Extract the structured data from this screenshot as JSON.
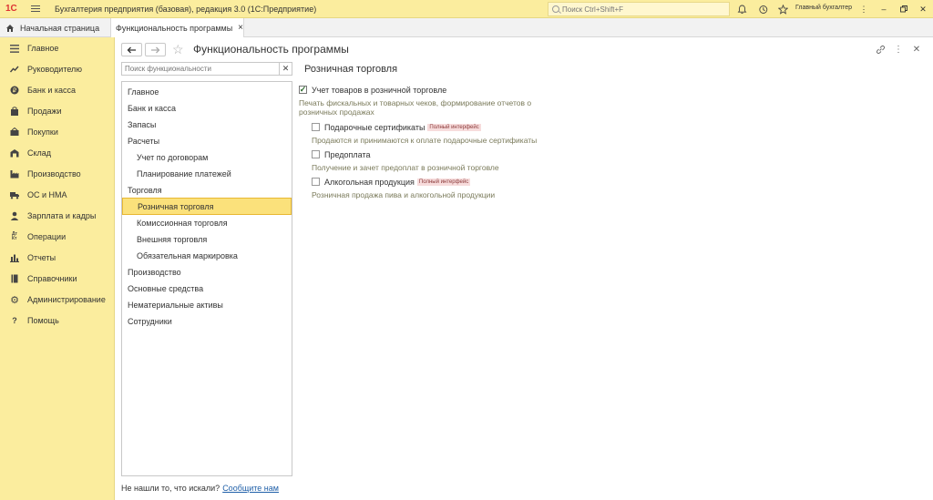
{
  "titlebar": {
    "logo": "1С",
    "app_title": "Бухгалтерия предприятия (базовая), редакция 3.0  (1С:Предприятие)",
    "search_placeholder": "Поиск Ctrl+Shift+F",
    "user": "Главный бухгалтер",
    "icons": [
      "bell-icon",
      "history-icon",
      "star-icon",
      "settings-icon"
    ],
    "window_buttons": [
      "minimize",
      "restore",
      "close"
    ]
  },
  "tabs": {
    "home_label": "Начальная страница",
    "active_label": "Функциональность программы",
    "close_symbol": "×"
  },
  "sidebar": {
    "items": [
      {
        "label": "Главное",
        "icon": "menu-icon"
      },
      {
        "label": "Руководителю",
        "icon": "chart-trend-icon"
      },
      {
        "label": "Банк и касса",
        "icon": "coin-icon"
      },
      {
        "label": "Продажи",
        "icon": "bag-icon"
      },
      {
        "label": "Покупки",
        "icon": "basket-icon"
      },
      {
        "label": "Склад",
        "icon": "warehouse-icon"
      },
      {
        "label": "Производство",
        "icon": "factory-icon"
      },
      {
        "label": "ОС и НМА",
        "icon": "truck-icon"
      },
      {
        "label": "Зарплата и кадры",
        "icon": "person-icon"
      },
      {
        "label": "Операции",
        "icon": "dt-kt-icon"
      },
      {
        "label": "Отчеты",
        "icon": "bar-chart-icon"
      },
      {
        "label": "Справочники",
        "icon": "book-icon"
      },
      {
        "label": "Администрирование",
        "icon": "gear-icon"
      },
      {
        "label": "Помощь",
        "icon": "question-icon"
      }
    ]
  },
  "main": {
    "title": "Функциональность программы",
    "filter_placeholder": "Поиск функциональности",
    "tree": [
      {
        "label": "Главное",
        "level": 0
      },
      {
        "label": "Банк и касса",
        "level": 0
      },
      {
        "label": "Запасы",
        "level": 0
      },
      {
        "label": "Расчеты",
        "level": 0
      },
      {
        "label": "Учет по договорам",
        "level": 1
      },
      {
        "label": "Планирование платежей",
        "level": 1
      },
      {
        "label": "Торговля",
        "level": 0
      },
      {
        "label": "Розничная торговля",
        "level": 1,
        "selected": true
      },
      {
        "label": "Комиссионная торговля",
        "level": 1
      },
      {
        "label": "Внешняя торговля",
        "level": 1
      },
      {
        "label": "Обязательная маркировка",
        "level": 1
      },
      {
        "label": "Производство",
        "level": 0
      },
      {
        "label": "Основные средства",
        "level": 0
      },
      {
        "label": "Нематериальные активы",
        "level": 0
      },
      {
        "label": "Сотрудники",
        "level": 0
      }
    ],
    "not_found_text": "Не нашли то, что искали?",
    "not_found_link": "Сообщите нам",
    "section": {
      "title": "Розничная торговля",
      "main_option": {
        "label": "Учет товаров в розничной торговле",
        "checked": true,
        "description_line1": "Печать фискальных и товарных чеков, формирование отчетов о",
        "description_line2": "розничных продажах"
      },
      "options": [
        {
          "label": "Подарочные сертификаты",
          "badge": "Полный интерфейс",
          "checked": false,
          "description": "Продаются и принимаются к оплате подарочные сертификаты"
        },
        {
          "label": "Предоплата",
          "badge": "",
          "checked": false,
          "description": "Получение и зачет предоплат в розничной торговле"
        },
        {
          "label": "Алкогольная продукция",
          "badge": "Полный интерфейс",
          "checked": false,
          "description": "Розничная продажа пива и алкогольной продукции"
        }
      ]
    }
  }
}
